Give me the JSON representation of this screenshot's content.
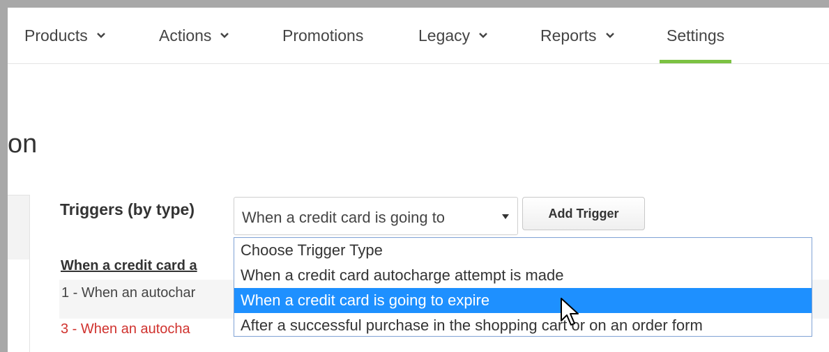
{
  "nav": {
    "items": [
      {
        "label": "Products",
        "has_dropdown": true
      },
      {
        "label": "Actions",
        "has_dropdown": true
      },
      {
        "label": "Promotions",
        "has_dropdown": false
      },
      {
        "label": "Legacy",
        "has_dropdown": true
      },
      {
        "label": "Reports",
        "has_dropdown": true
      },
      {
        "label": "Settings",
        "has_dropdown": false,
        "active": true
      }
    ],
    "active_color": "#7cc242"
  },
  "page": {
    "title": "on"
  },
  "triggers": {
    "label": "Triggers (by type)",
    "select_value": "When a credit card is going to",
    "add_button": "Add Trigger",
    "dropdown_options": [
      "Choose Trigger Type",
      "When a credit card autocharge attempt is made",
      "When a credit card is going to expire",
      "After a successful purchase in the shopping cart or on an order form"
    ],
    "selected_index": 2,
    "highlight_color": "#1e90ff"
  },
  "content": {
    "section_heading": "When a credit card a",
    "row1": "1 - When an autochar",
    "row3": "3 - When an autocha",
    "row3_color": "#d0322e"
  }
}
